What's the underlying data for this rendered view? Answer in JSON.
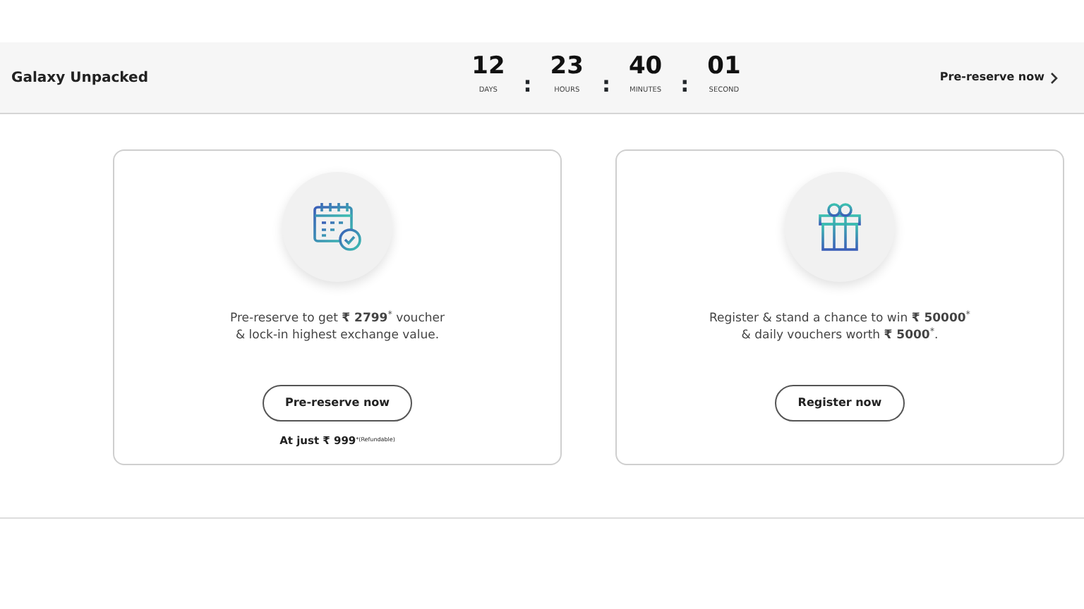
{
  "header": {
    "title": "Galaxy Unpacked",
    "countdown": [
      {
        "value": "12",
        "unit": "DAYS"
      },
      {
        "value": "23",
        "unit": "HOURS"
      },
      {
        "value": "40",
        "unit": "MINUTES"
      },
      {
        "value": "01",
        "unit": "SECOND"
      }
    ],
    "separator": ":",
    "link": "Pre-reserve now"
  },
  "cards": [
    {
      "kind": "calendar",
      "text": "Pre-reserve to get **₹ 2799**$^{*}$ voucher\n& lock-in highest exchange value.",
      "button": "Pre-reserve now",
      "note": "At just ₹ 999$^{*(Refundable)}$"
    },
    {
      "kind": "gift",
      "text": "Register & stand a chance to win **₹ 50000**$^{*}$\n& daily vouchers worth **₹ 5000**$^{*}$.",
      "button": "Register now"
    }
  ]
}
